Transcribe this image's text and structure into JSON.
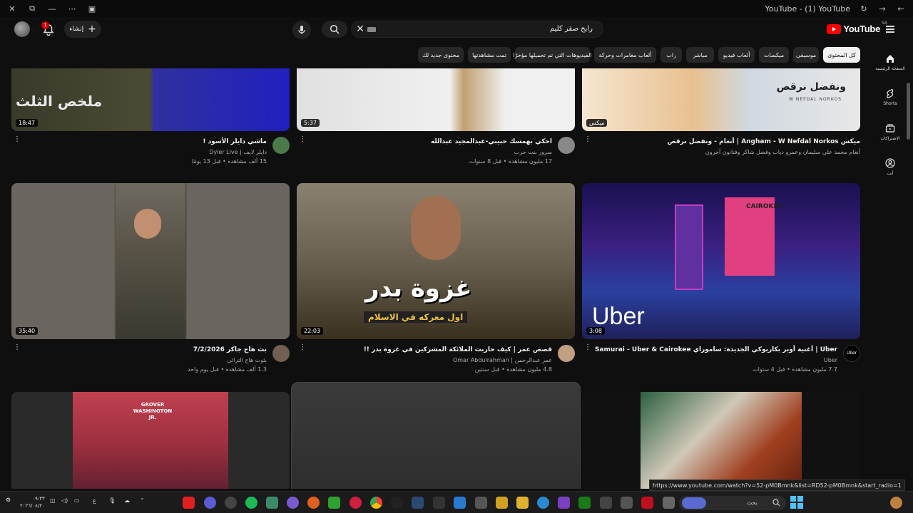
{
  "window": {
    "title": "YouTube - (1) YouTube"
  },
  "header": {
    "search_query": "رابح صقر كليم",
    "create_label": "إنشاء",
    "notifications_count": "1",
    "logo_text": "YouTube",
    "country_code": "SA"
  },
  "chips": [
    {
      "label": "كل المحتوى",
      "active": true
    },
    {
      "label": "موسيقى",
      "active": false
    },
    {
      "label": "ميكسات",
      "active": false
    },
    {
      "label": "ألعاب فيديو",
      "active": false
    },
    {
      "label": "مباشر",
      "active": false
    },
    {
      "label": "راب",
      "active": false
    },
    {
      "label": "ألعاب مغامرات وحركة",
      "active": false
    },
    {
      "label": "الفيديوهات التي تم تحميلها مؤخرًا",
      "active": false
    },
    {
      "label": "تمت مشاهدتها",
      "active": false
    },
    {
      "label": "محتوى جديد لك",
      "active": false
    }
  ],
  "sidebar": {
    "items": [
      {
        "label": "الصفحة الرئيسية",
        "icon": "home-icon"
      },
      {
        "label": "Shorts",
        "icon": "shorts-icon"
      },
      {
        "label": "الاشتراكات",
        "icon": "subscriptions-icon"
      },
      {
        "label": "أنت",
        "icon": "you-icon"
      }
    ]
  },
  "videos": [
    {
      "title": "ماشي دايلر الأسود !",
      "channel": "دايلر لايف | Dyler Live",
      "stats": "15 ألف مشاهدة • قبل 13 يومًا",
      "duration": "18:47",
      "thumb_text": "ملخص الثلث"
    },
    {
      "title": "احكي بهمسك حبيبي-عبدالمجيد عبدالله",
      "channel": "سرور بنت حرب",
      "stats": "17 مليون مشاهدة • قبل 8 سنوات",
      "duration": "5:37",
      "thumb_text": ""
    },
    {
      "title": "ميكس Angham - W Nefdal Norkos | أنغام - ونفضل نرقص",
      "channel": "أنغام محمد علي سليمان وعمرو دياب وفضل شاكر وفنانون آخرون",
      "stats": "",
      "duration": "ميكس",
      "thumb_text": "ونفضل نرقص",
      "thumb_subtext": "W NEFDAL NORKOS"
    },
    {
      "title": "بث هاج جاكر 7/2/2026",
      "channel": "بثوث هاج التراثي",
      "stats": "1.3 ألف مشاهدة • قبل يوم واحد",
      "duration": "35:40",
      "thumb_text": ""
    },
    {
      "title": "قصص عمر | كيف حاربت الملائكة المشركين في غزوة بدر !!",
      "channel": "عمر عبدالرحمن | Omar Abdulrahman",
      "stats": "4.8 مليون مشاهدة • قبل سنتين",
      "duration": "22:03",
      "thumb_text": "غزوة بدر",
      "thumb_subtext": "اول معركه في الاسلام"
    },
    {
      "title": "Uber | أغنية أوبر بكاريوكي الجديدة: ساموراي Samurai - Uber & Cairokee",
      "channel": "Uber",
      "stats": "7.7 مليون مشاهدة • قبل 4 سنوات",
      "duration": "3:08",
      "thumb_text": "Uber",
      "thumb_subtext": "CAIROKEE"
    },
    {
      "title": "",
      "channel": "",
      "stats": "",
      "duration": "",
      "thumb_text": "GROVER WASHINGTON JR."
    },
    {
      "title": "",
      "channel": "",
      "stats": "",
      "duration": "",
      "thumb_text": ""
    },
    {
      "title": "",
      "channel": "",
      "stats": "",
      "duration": "",
      "thumb_text": ""
    }
  ],
  "status_url": "https://www.youtube.com/watch?v=52-pM0Bmnk&list=RD52-pM0Bmnk&start_radio=1",
  "taskbar": {
    "search_label": "بحث",
    "time": "٠٩:٣٣",
    "date": "٢٠٢٦/٠٨/٢٠",
    "lang": "ع"
  }
}
